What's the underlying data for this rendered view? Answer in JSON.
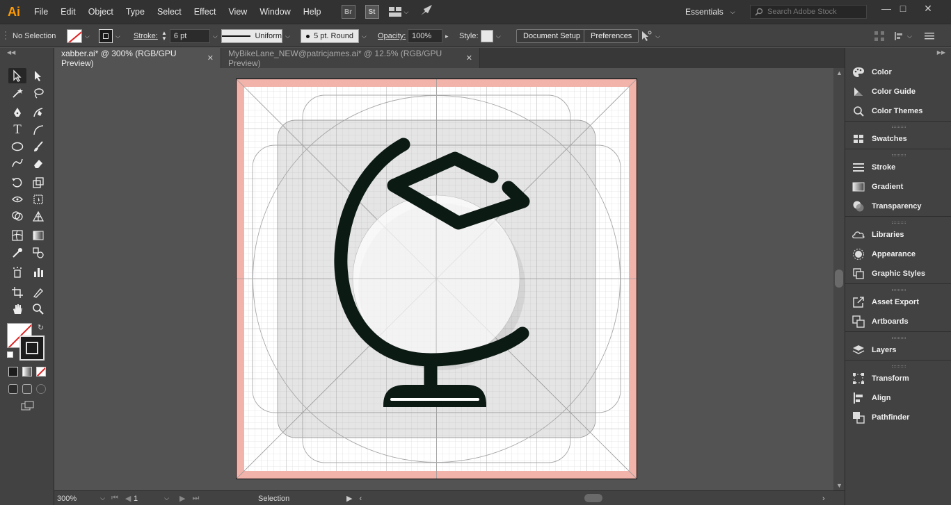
{
  "menubar": {
    "app_logo": "Ai",
    "items": [
      "File",
      "Edit",
      "Object",
      "Type",
      "Select",
      "Effect",
      "View",
      "Window",
      "Help"
    ],
    "bridge_label": "Br",
    "stock_label": "St",
    "workspace": "Essentials",
    "search_placeholder": "Search Adobe Stock"
  },
  "controlbar": {
    "selection_status": "No Selection",
    "stroke_label": "Stroke:",
    "stroke_weight": "6 pt",
    "stroke_profile": "Uniform",
    "brush": "5 pt. Round",
    "opacity_label": "Opacity:",
    "opacity_value": "100%",
    "style_label": "Style:",
    "document_setup": "Document Setup",
    "preferences": "Preferences"
  },
  "tabs": [
    {
      "label": "xabber.ai* @ 300% (RGB/GPU Preview)",
      "active": true
    },
    {
      "label": "MyBikeLane_NEW@patricjames.ai* @ 12.5% (RGB/GPU Preview)",
      "active": false
    }
  ],
  "statusbar": {
    "zoom": "300%",
    "artboard_number": "1",
    "current_tool": "Selection"
  },
  "panels": [
    {
      "group": 1,
      "items": [
        {
          "label": "Color",
          "icon": "color-palette-icon"
        },
        {
          "label": "Color Guide",
          "icon": "color-guide-icon"
        },
        {
          "label": "Color Themes",
          "icon": "color-themes-icon"
        }
      ]
    },
    {
      "group": 2,
      "items": [
        {
          "label": "Swatches",
          "icon": "swatches-icon"
        }
      ]
    },
    {
      "group": 3,
      "items": [
        {
          "label": "Stroke",
          "icon": "stroke-lines-icon"
        },
        {
          "label": "Gradient",
          "icon": "gradient-icon"
        },
        {
          "label": "Transparency",
          "icon": "transparency-icon"
        }
      ]
    },
    {
      "group": 4,
      "items": [
        {
          "label": "Libraries",
          "icon": "libraries-icon"
        },
        {
          "label": "Appearance",
          "icon": "appearance-icon"
        },
        {
          "label": "Graphic Styles",
          "icon": "graphic-styles-icon"
        }
      ]
    },
    {
      "group": 5,
      "items": [
        {
          "label": "Asset Export",
          "icon": "asset-export-icon"
        },
        {
          "label": "Artboards",
          "icon": "artboards-icon"
        }
      ]
    },
    {
      "group": 6,
      "items": [
        {
          "label": "Layers",
          "icon": "layers-icon"
        }
      ]
    },
    {
      "group": 7,
      "items": [
        {
          "label": "Transform",
          "icon": "transform-icon"
        },
        {
          "label": "Align",
          "icon": "align-icon"
        },
        {
          "label": "Pathfinder",
          "icon": "pathfinder-icon"
        }
      ]
    }
  ],
  "colors": {
    "artboard_bleed": "#f2b3ab",
    "artwork_stroke": "#0c1a14",
    "app_accent": "#ff9a00"
  }
}
